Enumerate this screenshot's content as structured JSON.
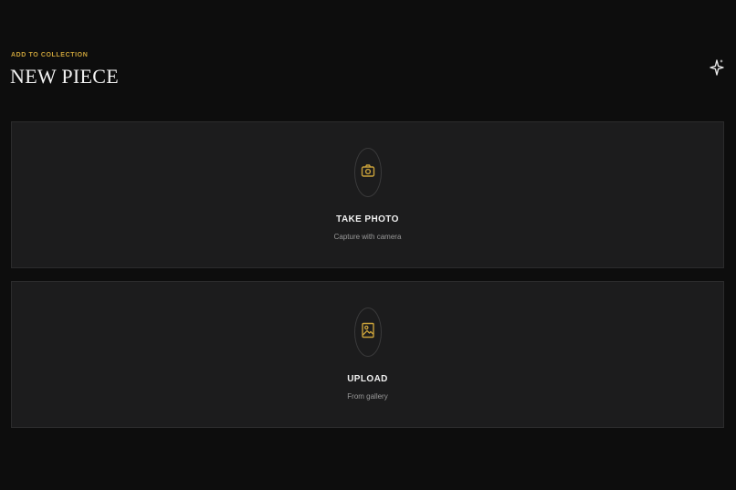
{
  "header": {
    "eyebrow": "ADD TO COLLECTION",
    "title": "NEW PIECE",
    "action_icon": "sparkle-icon"
  },
  "options": [
    {
      "label": "TAKE PHOTO",
      "subtitle": "Capture with camera",
      "icon": "camera-icon"
    },
    {
      "label": "UPLOAD",
      "subtitle": "From gallery",
      "icon": "image-icon"
    }
  ],
  "colors": {
    "background": "#0d0d0d",
    "card": "#1c1c1d",
    "accent": "#c9a13a",
    "text": "#f0f0f0",
    "muted": "#9a9a9a"
  }
}
